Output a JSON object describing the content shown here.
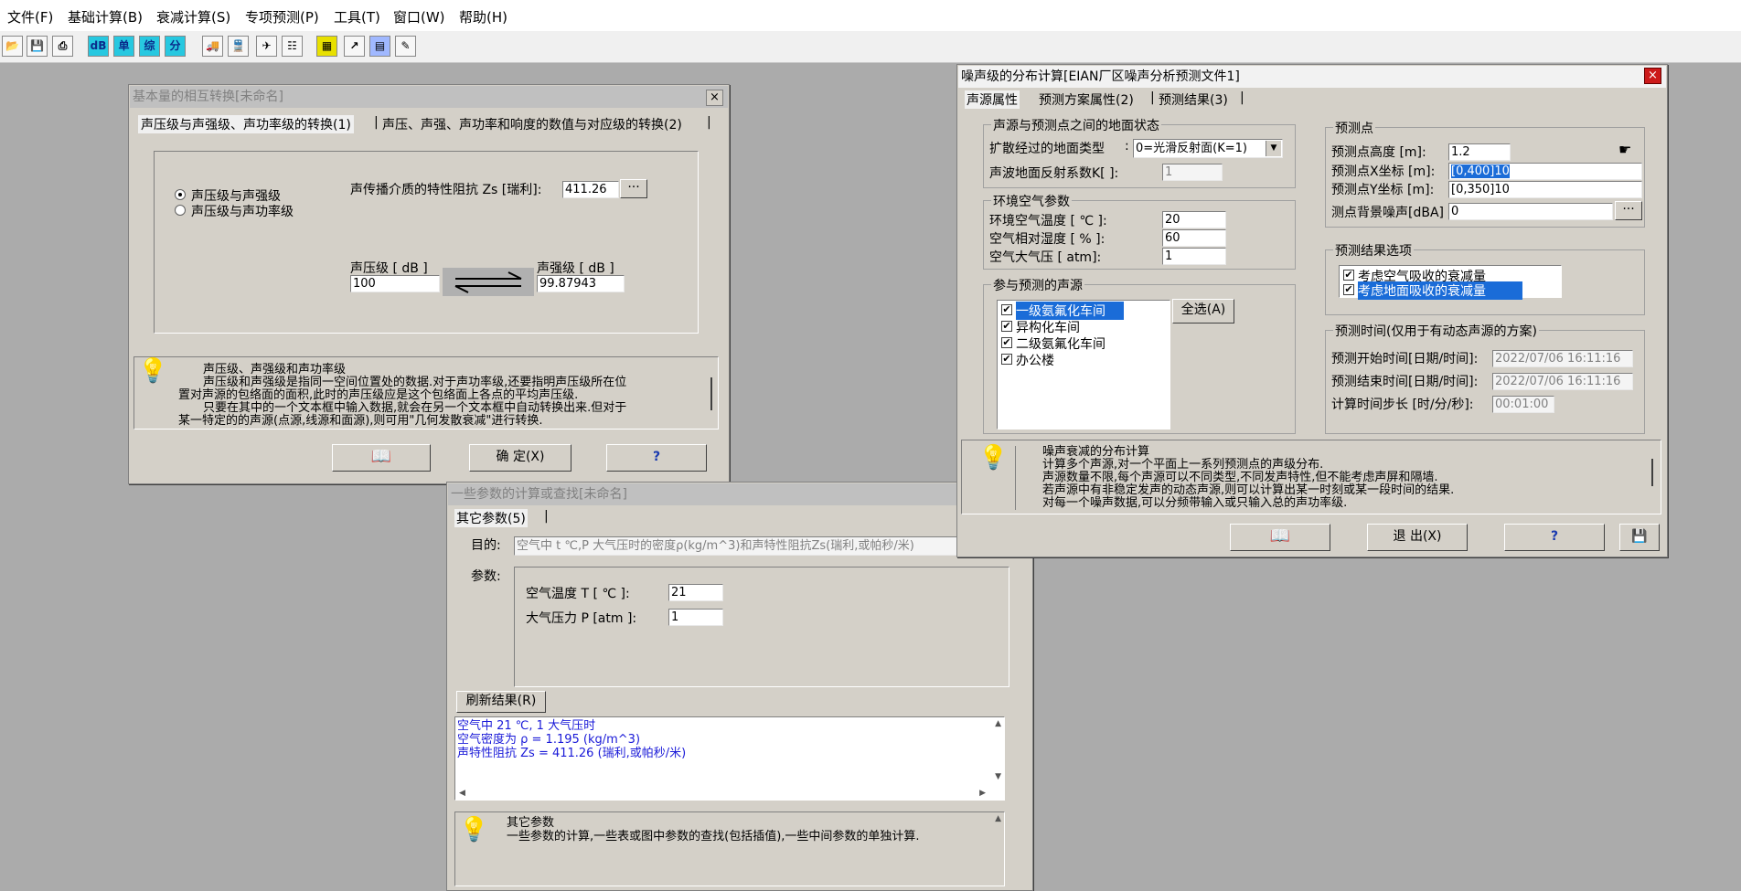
{
  "menu": {
    "items": [
      "文件(F)",
      "基础计算(B)",
      "衰减计算(S)",
      "专项预测(P)",
      "工具(T)",
      "窗口(W)",
      "帮助(H)"
    ]
  },
  "toolbar": {
    "db": "dB",
    "dan": "单",
    "zong": "综",
    "fen": "分"
  },
  "win1": {
    "title": "基本量的相互转换[未命名]",
    "tab1": "声压级与声强级、声功率级的转换(1)",
    "tab2": "声压、声强、声功率和响度的数值与对应级的转换(2)",
    "radio1": "声压级与声强级",
    "radio2": "声压级与声功率级",
    "impedance_label": "声传播介质的特性阻抗 Zs [瑞利]:",
    "impedance_value": "411.26",
    "more_btn": "···",
    "spl_label": "声压级 [ dB ]",
    "spl_value": "100",
    "sil_label": "声强级 [ dB ]",
    "sil_value": "99.87943",
    "info_title": "声压级、声强级和声功率级",
    "info_lines": [
      "声压级和声强级是指同一空间位置处的数据.对于声功率级,还要指明声压级所在位",
      "置对声源的包络面的面积,此时的声压级应是这个包络面上各点的平均声压级.",
      "只要在其中的一个文本框中输入数据,就会在另一个文本框中自动转换出来.但对于",
      "某一特定的的声源(点源,线源和面源),则可用\"几何发散衰减\"进行转换."
    ],
    "ok_btn": "确 定(X)",
    "help_btn": "?"
  },
  "win2": {
    "title": "一些参数的计算或查找[未命名]",
    "tab": "其它参数(5)",
    "purpose_label": "目的:",
    "purpose_value": "空气中 t ℃,P 大气压时的密度ρ(kg/m^3)和声特性阻抗Zs(瑞利,或帕秒/米)",
    "params_label": "参数:",
    "temp_label": "空气温度 T [ ℃ ]:",
    "temp_value": "21",
    "pressure_label": "大气压力 P [atm ]:",
    "pressure_value": "1",
    "refresh_btn": "刷新结果(R)",
    "result_lines": [
      "空气中 21 ℃, 1 大气压时",
      "    空气密度为 ρ = 1.195 (kg/m^3)",
      "    声特性阻抗 Zs = 411.26 (瑞利,或帕秒/米)"
    ],
    "info_title": "其它参数",
    "info_text": "一些参数的计算,一些表或图中参数的查找(包括插值),一些中间参数的单独计算."
  },
  "win3": {
    "title": "噪声级的分布计算[EIAN厂区噪声分析预测文件1]",
    "tab1": "声源属性",
    "tab2": "预测方案属性(2)",
    "tab3": "预测结果(3)",
    "ground_group": "声源与预测点之间的地面状态",
    "ground_type_label": "扩散经过的地面类型",
    "ground_type_value": "0=光滑反射面(K=1)",
    "reflect_label": "声波地面反射系数K[ ]:",
    "reflect_value": "1",
    "env_group": "环境空气参数",
    "env_temp_label": "环境空气温度  [ ℃ ]:",
    "env_temp_value": "20",
    "humidity_label": "空气相对湿度  [  % ]:",
    "humidity_value": "60",
    "atm_label": "空气大气压    [ atm]:",
    "atm_value": "1",
    "sources_group": "参与预测的声源",
    "sources": [
      "一级氨氟化车间",
      "异构化车间",
      "二级氨氟化车间",
      "办公楼"
    ],
    "select_all_btn": "全选(A)",
    "point_group": "预测点",
    "height_label": "预测点高度  [m]:",
    "height_value": "1.2",
    "x_label": "预测点X坐标 [m]:",
    "x_value": "[0,400]10",
    "y_label": "预测点Y坐标 [m]:",
    "y_value": "[0,350]10",
    "bg_label": "测点背景噪声[dBA]",
    "bg_value": "0",
    "result_group": "预测结果选项",
    "opt1": "考虑空气吸收的衰减量",
    "opt2": "考虑地面吸收的衰减量",
    "time_group": "预测时间(仅用于有动态声源的方案)",
    "start_label": "预测开始时间[日期/时间]:",
    "start_value": "2022/07/06 16:11:16",
    "end_label": "预测结束时间[日期/时间]:",
    "end_value": "2022/07/06 16:11:16",
    "step_label": "计算时间步长 [时/分/秒]:",
    "step_value": "00:01:00",
    "info_title": "噪声衰减的分布计算",
    "info_lines": [
      "计算多个声源,对一个平面上一系列预测点的声级分布.",
      "声源数量不限,每个声源可以不同类型,不同发声特性,但不能考虑声屏和隔墙.",
      "若声源中有非稳定发声的动态声源,则可以计算出某一时刻或某一段时间的结果.",
      "对每一个噪声数据,可以分频带输入或只输入总的声功率级."
    ],
    "exit_btn": "退 出(X)",
    "help_btn": "?"
  }
}
